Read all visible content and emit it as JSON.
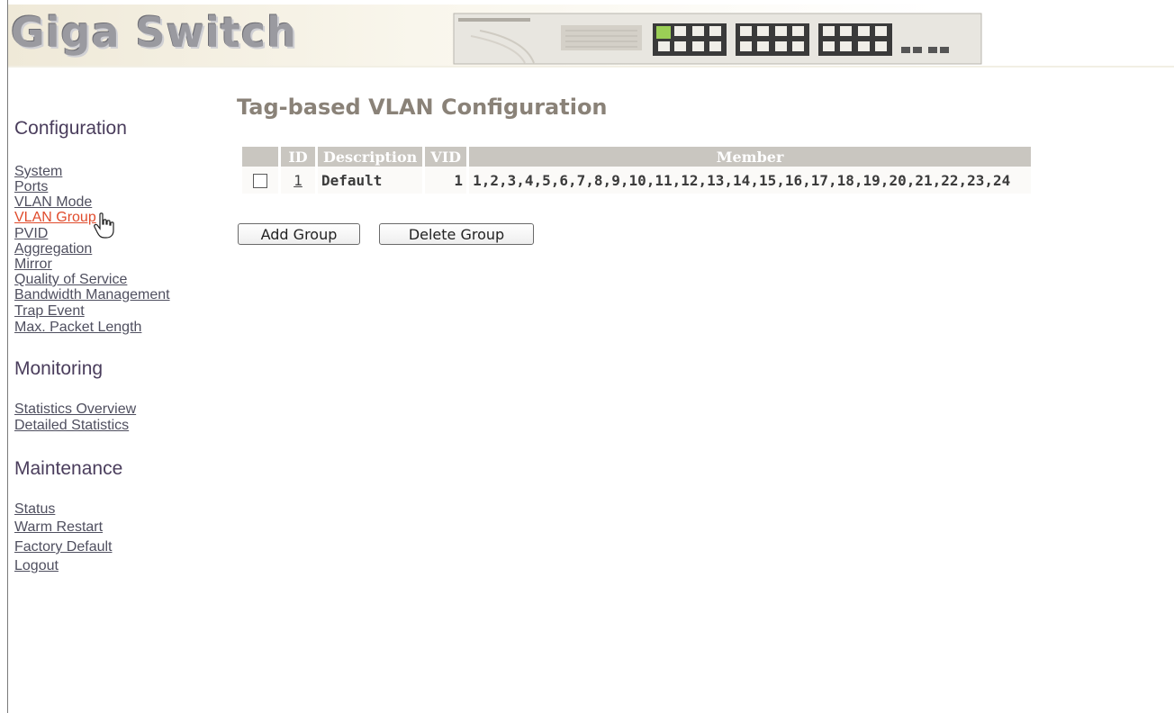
{
  "header": {
    "brand": "Giga Switch"
  },
  "nav": {
    "configuration": {
      "heading": "Configuration",
      "items": [
        "System",
        "Ports",
        "VLAN Mode",
        "VLAN Group",
        "PVID",
        "Aggregation",
        "Mirror",
        "Quality of Service",
        "Bandwidth Management",
        "Trap Event",
        "Max. Packet Length"
      ],
      "active": "VLAN Group"
    },
    "monitoring": {
      "heading": "Monitoring",
      "items": [
        "Statistics Overview",
        "Detailed Statistics"
      ]
    },
    "maintenance": {
      "heading": "Maintenance",
      "items": [
        "Status",
        "Warm Restart",
        "Factory Default",
        "Logout"
      ]
    }
  },
  "main": {
    "title": "Tag-based VLAN Configuration",
    "table": {
      "columns": [
        "ID",
        "Description",
        "VID",
        "Member"
      ],
      "rows": [
        {
          "checked": false,
          "id": "1",
          "description": "Default",
          "vid": "1",
          "member": "1,2,3,4,5,6,7,8,9,10,11,12,13,14,15,16,17,18,19,20,21,22,23,24"
        }
      ]
    },
    "buttons": {
      "add": "Add Group",
      "delete": "Delete Group"
    }
  },
  "colors": {
    "accent_active_link": "#e04b2c",
    "heading": "#4a3d5c",
    "table_header_bg": "#c9c6c0"
  },
  "icons": {
    "cursor": "hand-pointer-icon",
    "switch_image": "switch-device-icon"
  }
}
